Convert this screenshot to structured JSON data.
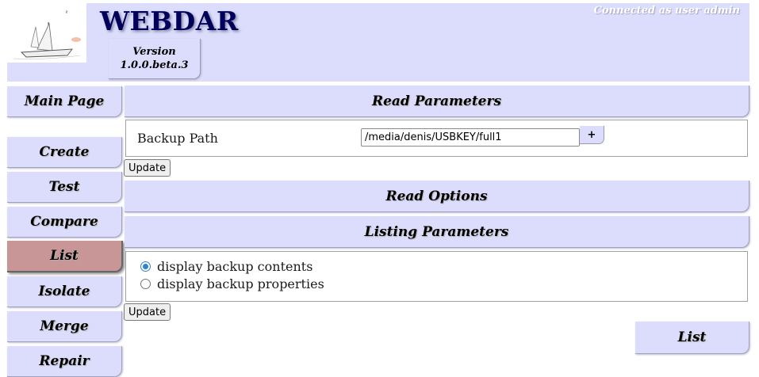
{
  "header": {
    "title": "WEBDAR",
    "version_label": "Version",
    "version_number": "1.0.0.beta.3",
    "connected_text": "Connected as user admin",
    "logo_icon": "sailboat-icon"
  },
  "menu": {
    "items": [
      {
        "label": "Main Page"
      },
      {
        "label": "Create"
      },
      {
        "label": "Test"
      },
      {
        "label": "Compare"
      },
      {
        "label": "List",
        "selected": true
      },
      {
        "label": "Isolate"
      },
      {
        "label": "Merge"
      },
      {
        "label": "Repair"
      }
    ]
  },
  "read_parameters": {
    "title": "Read Parameters",
    "backup_path_label": "Backup Path",
    "backup_path_value": "/media/denis/USBKEY/full1",
    "plus_label": "+",
    "update_label": "Update"
  },
  "read_options": {
    "title": "Read Options"
  },
  "listing_parameters": {
    "title": "Listing Parameters",
    "options": [
      {
        "label": "display backup contents",
        "checked": true
      },
      {
        "label": "display backup properties",
        "checked": false
      }
    ],
    "update_label": "Update"
  },
  "action": {
    "list_label": "List"
  },
  "colors": {
    "panel_bg": "#dcdcfc",
    "selected_bg": "#c89696",
    "title_color": "#00005a",
    "radio_accent": "#2f83c9"
  }
}
